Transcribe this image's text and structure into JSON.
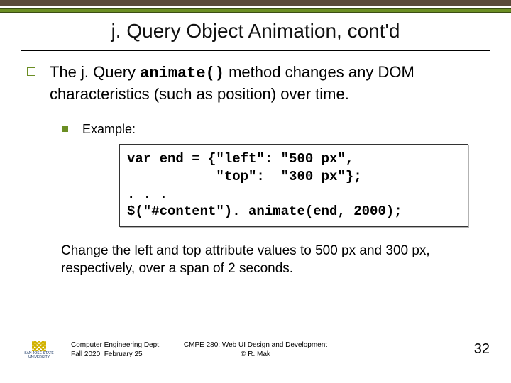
{
  "title": "j. Query Object Animation, cont'd",
  "bullet1_prefix": "The j. Query ",
  "bullet1_code": "animate()",
  "bullet1_suffix": " method changes any DOM characteristics (such as position) over time.",
  "bullet2": "Example:",
  "code": "var end = {\"left\": \"500 px\",\n           \"top\":  \"300 px\"};\n. . .\n$(\"#content\"). animate(end, 2000);",
  "explain": "Change the left and top attribute values to 500 px and 300 px, respectively, over a span of 2 seconds.",
  "footer_left_line1": "Computer Engineering Dept.",
  "footer_left_line2": "Fall 2020: February 25",
  "footer_center_line1": "CMPE 280: Web UI Design and Development",
  "footer_center_line2": "© R. Mak",
  "page_number": "32",
  "logo_text": "SAN JOSÉ STATE UNIVERSITY"
}
